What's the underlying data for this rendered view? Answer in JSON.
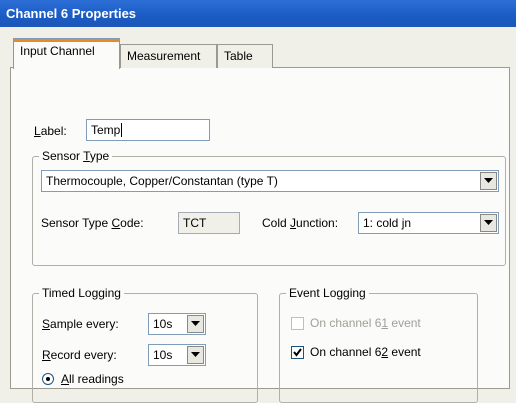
{
  "window": {
    "title": "Channel 6 Properties"
  },
  "tabs": [
    {
      "label": "Input Channel",
      "active": true
    },
    {
      "label": "Measurement",
      "active": false
    },
    {
      "label": "Table",
      "active": false
    }
  ],
  "label_field": {
    "label_prefix": "L",
    "label_rest": "abel:",
    "value": "Temp"
  },
  "sensor_type": {
    "group_prefix": "Sensor ",
    "group_accel": "T",
    "group_rest": "ype",
    "selected": "Thermocouple, Copper/Constantan (type T)",
    "code_prefix": "Sensor Type ",
    "code_accel": "C",
    "code_rest": "ode:",
    "code_value": "TCT",
    "cold_prefix": "Cold ",
    "cold_accel": "J",
    "cold_rest": "unction:",
    "cold_value": "1:  cold jn"
  },
  "timed_logging": {
    "title": "Timed Logging",
    "sample_accel": "S",
    "sample_rest": "ample every:",
    "sample_value": "10s",
    "record_accel": "R",
    "record_rest": "ecord every:",
    "record_value": "10s",
    "all_accel": "A",
    "all_rest": "ll readings"
  },
  "event_logging": {
    "title": "Event Logging",
    "ch61_prefix": "On channel 6",
    "ch61_accel": "1",
    "ch61_rest": " event",
    "ch61_checked": false,
    "ch61_enabled": false,
    "ch62_prefix": "On channel 6",
    "ch62_accel": "2",
    "ch62_rest": " event",
    "ch62_checked": true,
    "ch62_enabled": true
  },
  "colors": {
    "title_bar": "#1a5bc4",
    "tab_accent": "#e68b2c",
    "dialog_bg": "#f0f0e8"
  }
}
